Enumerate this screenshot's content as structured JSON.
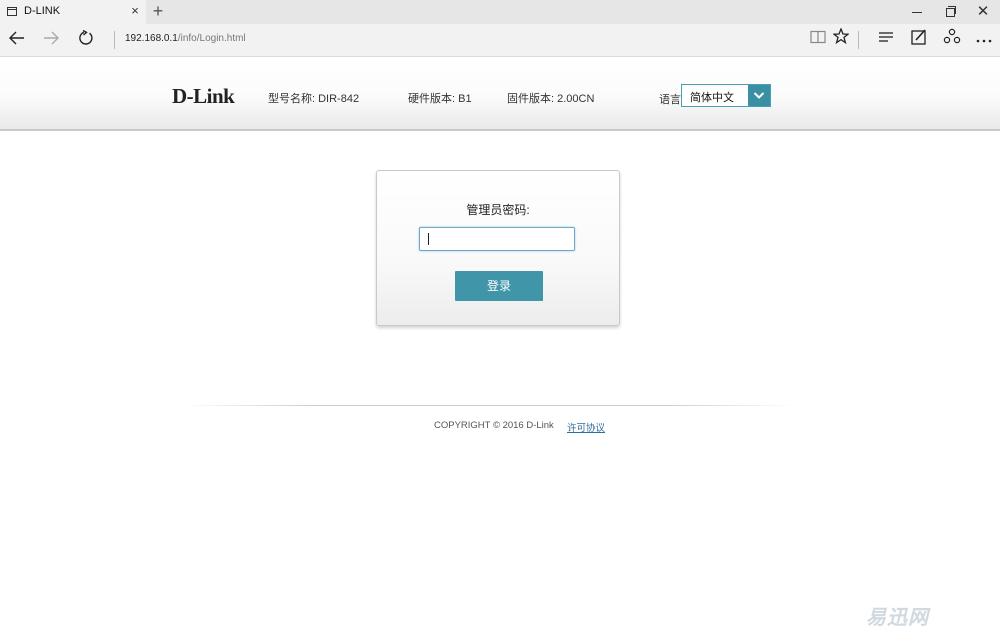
{
  "browser": {
    "tab_title": "D-LINK",
    "tab_close": "×",
    "new_tab": "+",
    "window_close": "✕",
    "url_host": "192.168.0.1",
    "url_path": "/info/Login.html"
  },
  "header": {
    "logo": "D-Link",
    "model": "型号名称: DIR-842",
    "hardware": "硬件版本: B1",
    "firmware": "固件版本: 2.00CN",
    "language_label": "语言:",
    "language_selected": "简体中文"
  },
  "login": {
    "password_label": "管理员密码:",
    "password_value": "",
    "submit_label": "登录"
  },
  "footer": {
    "copyright": "COPYRIGHT © 2016 D-Link",
    "license_link": "许可协议"
  },
  "watermark": "易迅网",
  "colors": {
    "accent": "#4195a8",
    "header_gradient_end": "#e9e9e9",
    "link": "#2f6f9c"
  },
  "icons": [
    "page-icon",
    "close-icon",
    "plus-icon",
    "minimize-icon",
    "restore-icon",
    "back-arrow-icon",
    "forward-arrow-icon",
    "refresh-icon",
    "reading-view-icon",
    "star-icon",
    "hub-icon",
    "web-note-icon",
    "share-icon",
    "more-icon",
    "chevron-down-icon"
  ]
}
